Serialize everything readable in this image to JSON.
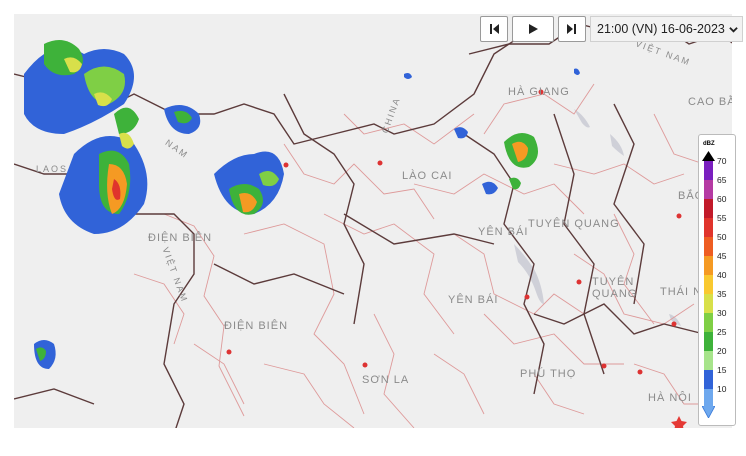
{
  "map": {
    "labels": [
      {
        "text": "VIỆT NAM",
        "kind": "country"
      },
      {
        "text": "CHINA",
        "kind": "country"
      },
      {
        "text": "HÀ GIANG",
        "kind": "province"
      },
      {
        "text": "CAO BẰ",
        "kind": "province"
      },
      {
        "text": "LÀO CAI",
        "kind": "province"
      },
      {
        "text": "BẮC KẠ",
        "kind": "province"
      },
      {
        "text": "TUYÊN QUANG",
        "kind": "province"
      },
      {
        "text": "YÊN BÁI",
        "kind": "province"
      },
      {
        "text": "ĐIỆN BIÊN",
        "kind": "province"
      },
      {
        "text": "THÁI NG",
        "kind": "province"
      },
      {
        "text": "TUYÊN QUANG",
        "kind": "province"
      },
      {
        "text": "YÊN BÁI",
        "kind": "province"
      },
      {
        "text": "ĐIỆN BIÊN",
        "kind": "province"
      },
      {
        "text": "SƠN LA",
        "kind": "province"
      },
      {
        "text": "PHÚ THỌ",
        "kind": "province"
      },
      {
        "text": "HÀ NỘI",
        "kind": "province"
      },
      {
        "text": "LAOS",
        "kind": "country"
      },
      {
        "text": "NAM",
        "kind": "country"
      },
      {
        "text": "VIỆT NAM",
        "kind": "country"
      }
    ],
    "colors": {
      "land": "#efefef",
      "province_border": "#de9a9a",
      "national_border": "#5c3b3b",
      "river": "#c9c9d2"
    }
  },
  "controls": {
    "first_icon": "skip-to-start-icon",
    "play_icon": "play-icon",
    "last_icon": "skip-to-end-icon",
    "time_value": "21:00 (VN) 16-06-2023",
    "dropdown_icon": "chevron-down-icon"
  },
  "legend": {
    "unit": "dBZ",
    "ticks": [
      "70",
      "65",
      "60",
      "55",
      "50",
      "45",
      "40",
      "35",
      "30",
      "25",
      "20",
      "15",
      "10"
    ],
    "colors": {
      "70": "#7a1fbf",
      "65": "#b53aa3",
      "60": "#c21a2a",
      "55": "#e0342c",
      "50": "#ee5d22",
      "45": "#f59a23",
      "40": "#f9c930",
      "35": "#d8e04a",
      "30": "#7fcf45",
      "25": "#3eb23a",
      "20": "#a7e48b",
      "15": "#3163d8",
      "10": "#6ea8ee"
    }
  }
}
